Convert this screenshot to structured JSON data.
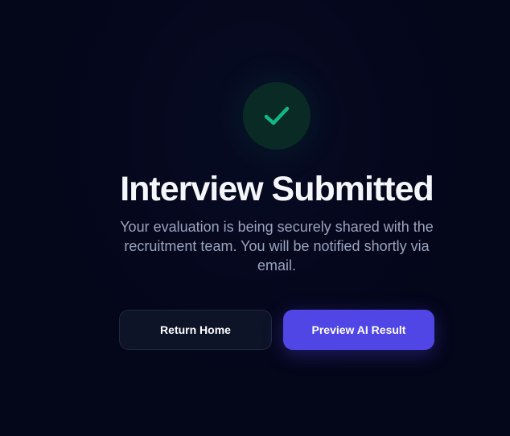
{
  "status": {
    "icon": "checkmark-icon",
    "color": "#10b981"
  },
  "heading": {
    "title": "Interview Submitted",
    "message": "Your evaluation is being securely shared with the recruitment team. You will be notified shortly via email."
  },
  "actions": {
    "return_home_label": "Return Home",
    "preview_result_label": "Preview AI Result",
    "primary_color": "#4f46e5"
  }
}
